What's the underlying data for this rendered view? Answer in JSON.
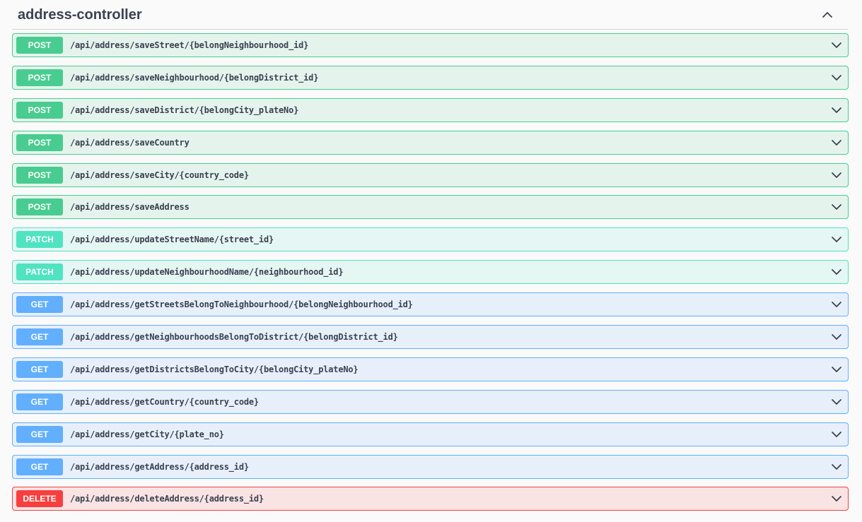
{
  "section": {
    "title": "address-controller",
    "toggle_icon": "chevron-up-icon"
  },
  "operations": [
    {
      "method": "POST",
      "path": "/api/address/saveStreet/{belongNeighbourhood_id}",
      "type": "post"
    },
    {
      "method": "POST",
      "path": "/api/address/saveNeighbourhood/{belongDistrict_id}",
      "type": "post"
    },
    {
      "method": "POST",
      "path": "/api/address/saveDistrict/{belongCity_plateNo}",
      "type": "post"
    },
    {
      "method": "POST",
      "path": "/api/address/saveCountry",
      "type": "post"
    },
    {
      "method": "POST",
      "path": "/api/address/saveCity/{country_code}",
      "type": "post"
    },
    {
      "method": "POST",
      "path": "/api/address/saveAddress",
      "type": "post"
    },
    {
      "method": "PATCH",
      "path": "/api/address/updateStreetName/{street_id}",
      "type": "patch"
    },
    {
      "method": "PATCH",
      "path": "/api/address/updateNeighbourhoodName/{neighbourhood_id}",
      "type": "patch"
    },
    {
      "method": "GET",
      "path": "/api/address/getStreetsBelongToNeighbourhood/{belongNeighbourhood_id}",
      "type": "get"
    },
    {
      "method": "GET",
      "path": "/api/address/getNeighbourhoodsBelongToDistrict/{belongDistrict_id}",
      "type": "get"
    },
    {
      "method": "GET",
      "path": "/api/address/getDistrictsBelongToCity/{belongCity_plateNo}",
      "type": "get"
    },
    {
      "method": "GET",
      "path": "/api/address/getCountry/{country_code}",
      "type": "get"
    },
    {
      "method": "GET",
      "path": "/api/address/getCity/{plate_no}",
      "type": "get"
    },
    {
      "method": "GET",
      "path": "/api/address/getAddress/{address_id}",
      "type": "get"
    },
    {
      "method": "DELETE",
      "path": "/api/address/deleteAddress/{address_id}",
      "type": "delete"
    }
  ],
  "colors": {
    "post": "#49cc90",
    "patch": "#50e3c2",
    "get": "#61affe",
    "delete": "#f93e3e",
    "text": "#3b4151"
  },
  "expand_icon": "chevron-down-icon"
}
